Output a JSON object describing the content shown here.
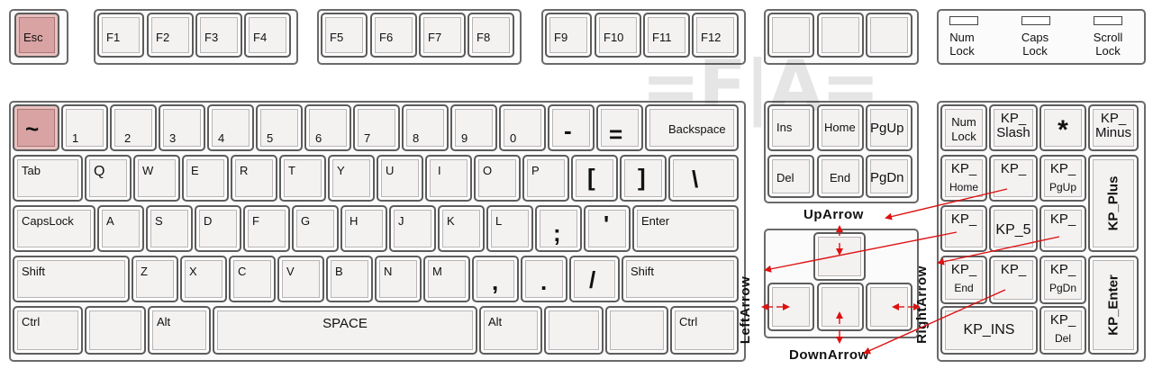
{
  "watermark": "=F|A=",
  "indicators": [
    "Num\nLock",
    "Caps\nLock",
    "Scroll\nLock"
  ],
  "keys": {
    "esc": "Esc",
    "f1": "F1",
    "f2": "F2",
    "f3": "F3",
    "f4": "F4",
    "f5": "F5",
    "f6": "F6",
    "f7": "F7",
    "f8": "F8",
    "f9": "F9",
    "f10": "F10",
    "f11": "F11",
    "f12": "F12",
    "tilde": "~",
    "n1": "1",
    "n2": "2",
    "n3": "3",
    "n4": "4",
    "n5": "5",
    "n6": "6",
    "n7": "7",
    "n8": "8",
    "n9": "9",
    "n0": "0",
    "minus": "-",
    "equal": "=",
    "backspace": "Backspace",
    "tab": "Tab",
    "q": "Q",
    "w": "W",
    "e": "E",
    "r": "R",
    "t": "T",
    "y": "Y",
    "u": "U",
    "i": "I",
    "o": "O",
    "p": "P",
    "lbracket": "[",
    "rbracket": "]",
    "backslash": "\\",
    "capslock": "CapsLock",
    "a": "A",
    "s": "S",
    "d": "D",
    "f": "F",
    "g": "G",
    "h": "H",
    "j": "J",
    "k": "K",
    "l": "L",
    "semicolon": ";",
    "quote": "'",
    "enter": "Enter",
    "lshift": "Shift",
    "z": "Z",
    "x": "X",
    "c": "C",
    "v": "V",
    "b": "B",
    "n": "N",
    "m": "M",
    "comma": ",",
    "period": ".",
    "slash": "/",
    "rshift": "Shift",
    "lctrl": "Ctrl",
    "lalt": "Alt",
    "space": "SPACE",
    "ralt": "Alt",
    "rctrl": "Ctrl",
    "ins": "Ins",
    "home": "Home",
    "pgup": "PgUp",
    "del": "Del",
    "end": "End",
    "pgdn": "PgDn",
    "numlock": "Num\nLock",
    "kp_slash": "KP_\nSlash",
    "kp_star": "*",
    "kp_minus": "KP_\nMinus",
    "kp_home_a": "KP_",
    "kp_home_b": "Home",
    "kp_up": "KP_",
    "kp_pgup_a": "KP_",
    "kp_pgup_b": "PgUp",
    "kp_plus": "KP_Plus",
    "kp_left": "KP_",
    "kp_5": "KP_5",
    "kp_right": "KP_",
    "kp_end_a": "KP_",
    "kp_end_b": "End",
    "kp_down": "KP_",
    "kp_pgdn_a": "KP_",
    "kp_pgdn_b": "PgDn",
    "kp_enter": "KP_Enter",
    "kp_ins": "KP_INS",
    "kp_del_a": "KP_",
    "kp_del_b": "Del"
  },
  "arrow_labels": {
    "up": "UpArrow",
    "left": "LeftArrow",
    "down": "DownArrow",
    "right": "RightArrow"
  }
}
